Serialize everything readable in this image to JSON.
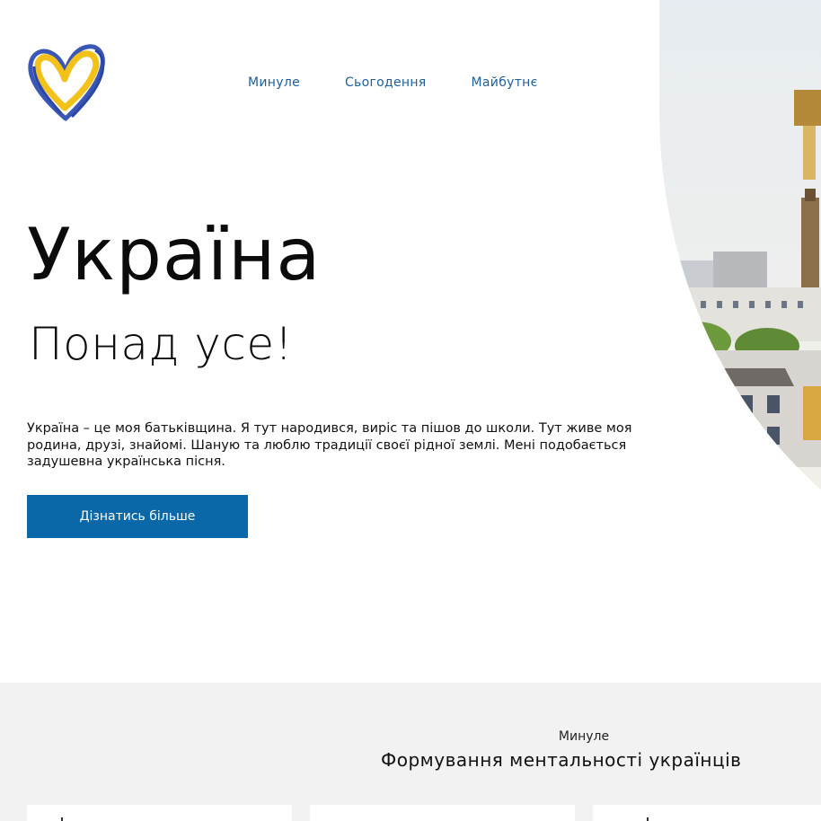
{
  "header": {
    "logo_icon": "heart-icon",
    "nav": [
      {
        "label": "Минуле"
      },
      {
        "label": "Сьогодення"
      },
      {
        "label": "Майбутнє"
      }
    ]
  },
  "hero": {
    "title": "Україна",
    "subtitle": "Понад усе!",
    "intro": "Україна – це моя батьківщина. Я тут народився, виріс та пішов до школи. Тут живе моя родина, друзі, знайомі. Шаную та люблю традиції своєї рідної землі. Мені подобається задушевна українська пісня.",
    "cta_label": "Дізнатись більше"
  },
  "section": {
    "eyebrow": "Минуле",
    "title": "Формування ментальності українців"
  },
  "colors": {
    "accent": "#0a67a8",
    "nav_text": "#1f5f9a",
    "section_bg": "#f2f2f2",
    "heart_blue": "#3b57b5",
    "heart_yellow": "#f2c21b"
  }
}
